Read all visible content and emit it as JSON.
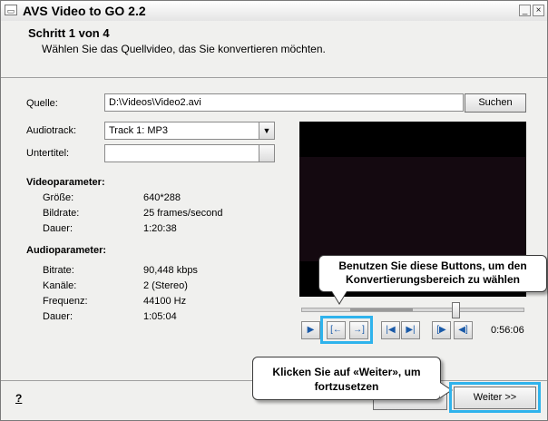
{
  "window": {
    "title": "AVS Video to GO 2.2",
    "minimize_glyph": "_",
    "close_glyph": "×",
    "icon": "app-icon"
  },
  "header": {
    "step": "Schritt 1 von 4",
    "instruction": "Wählen Sie das Quellvideo, das Sie konvertieren möchten."
  },
  "form": {
    "source_label": "Quelle:",
    "source_value": "D:\\Videos\\Video2.avi",
    "search_button": "Suchen",
    "audiotrack_label": "Audiotrack:",
    "audiotrack_value": "Track 1: MP3",
    "subtitle_label": "Untertitel:",
    "subtitle_value": ""
  },
  "video_params": {
    "heading": "Videoparameter:",
    "rows": [
      {
        "label": "Größe:",
        "value": "640*288"
      },
      {
        "label": "Bildrate:",
        "value": "25 frames/second"
      },
      {
        "label": "Dauer:",
        "value": "1:20:38"
      }
    ]
  },
  "audio_params": {
    "heading": "Audioparameter:",
    "rows": [
      {
        "label": "Bitrate:",
        "value": "90,448 kbps"
      },
      {
        "label": "Kanäle:",
        "value": "2 (Stereo)"
      },
      {
        "label": "Frequenz:",
        "value": "44100 Hz"
      },
      {
        "label": "Dauer:",
        "value": "1:05:04"
      }
    ]
  },
  "player": {
    "time": "0:56:06",
    "position_fraction": 0.69,
    "selection_start_fraction": 0.22,
    "selection_end_fraction": 0.5
  },
  "tooltips": {
    "buttons_tip": "Benutzen Sie diese Buttons, um den Konvertierungsbereich zu wählen",
    "next_tip": "Klicken Sie auf «Weiter», um fortzusetzen"
  },
  "footer": {
    "help": "?",
    "next_button": "Weiter >>"
  },
  "colors": {
    "highlight": "#2fb3ec",
    "control_icon": "#1a5aa8"
  }
}
